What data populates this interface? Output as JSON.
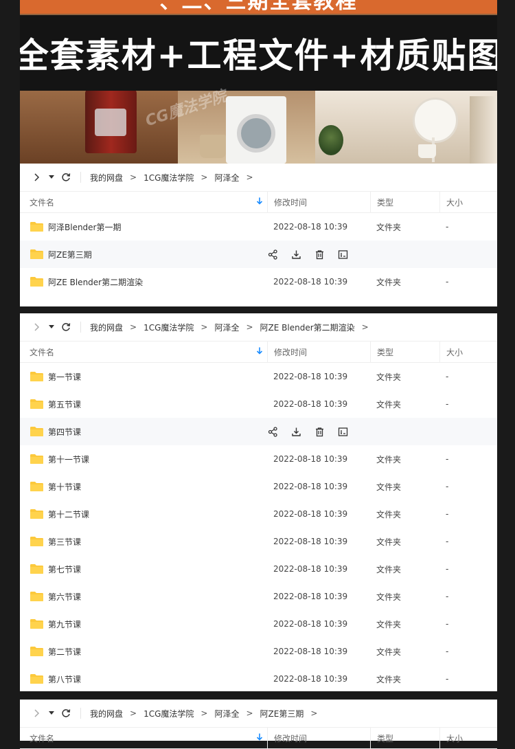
{
  "banner": {
    "top_text": "、二、三期全套教程",
    "headline": "全套素材+工程文件+材质贴图",
    "watermark": "CG魔法学院"
  },
  "columns": {
    "name": "文件名",
    "time": "修改时间",
    "type": "类型",
    "size": "大小"
  },
  "panels": [
    {
      "breadcrumb": [
        "我的网盘",
        "1CG魔法学院",
        "阿泽全"
      ],
      "rows": [
        {
          "name": "阿泽Blender第一期",
          "time": "2022-08-18 10:39",
          "type": "文件夹",
          "size": "-",
          "hover": false
        },
        {
          "name": "阿ZE第三期",
          "time": "",
          "type": "",
          "size": "",
          "hover": true
        },
        {
          "name": "阿ZE Blender第二期渲染",
          "time": "2022-08-18 10:39",
          "type": "文件夹",
          "size": "-",
          "hover": false
        }
      ]
    },
    {
      "breadcrumb": [
        "我的网盘",
        "1CG魔法学院",
        "阿泽全",
        "阿ZE Blender第二期渲染"
      ],
      "rows": [
        {
          "name": "第一节课",
          "time": "2022-08-18 10:39",
          "type": "文件夹",
          "size": "-",
          "hover": false
        },
        {
          "name": "第五节课",
          "time": "2022-08-18 10:39",
          "type": "文件夹",
          "size": "-",
          "hover": false
        },
        {
          "name": "第四节课",
          "time": "",
          "type": "",
          "size": "",
          "hover": true
        },
        {
          "name": "第十一节课",
          "time": "2022-08-18 10:39",
          "type": "文件夹",
          "size": "-",
          "hover": false
        },
        {
          "name": "第十节课",
          "time": "2022-08-18 10:39",
          "type": "文件夹",
          "size": "-",
          "hover": false
        },
        {
          "name": "第十二节课",
          "time": "2022-08-18 10:39",
          "type": "文件夹",
          "size": "-",
          "hover": false
        },
        {
          "name": "第三节课",
          "time": "2022-08-18 10:39",
          "type": "文件夹",
          "size": "-",
          "hover": false
        },
        {
          "name": "第七节课",
          "time": "2022-08-18 10:39",
          "type": "文件夹",
          "size": "-",
          "hover": false
        },
        {
          "name": "第六节课",
          "time": "2022-08-18 10:39",
          "type": "文件夹",
          "size": "-",
          "hover": false
        },
        {
          "name": "第九节课",
          "time": "2022-08-18 10:39",
          "type": "文件夹",
          "size": "-",
          "hover": false
        },
        {
          "name": "第二节课",
          "time": "2022-08-18 10:39",
          "type": "文件夹",
          "size": "-",
          "hover": false
        },
        {
          "name": "第八节课",
          "time": "2022-08-18 10:39",
          "type": "文件夹",
          "size": "-",
          "hover": false
        }
      ]
    },
    {
      "breadcrumb": [
        "我的网盘",
        "1CG魔法学院",
        "阿泽全",
        "阿ZE第三期"
      ],
      "rows": []
    }
  ],
  "colors": {
    "folder": "#fcc93c",
    "accent": "#1a8cff",
    "background": "#1a1a1a"
  },
  "icons": {
    "nav": [
      "chevron-right-icon",
      "dropdown-icon",
      "refresh-icon"
    ],
    "row_actions": [
      "share-icon",
      "download-icon",
      "delete-icon",
      "rename-icon"
    ],
    "folder": "folder-icon"
  }
}
